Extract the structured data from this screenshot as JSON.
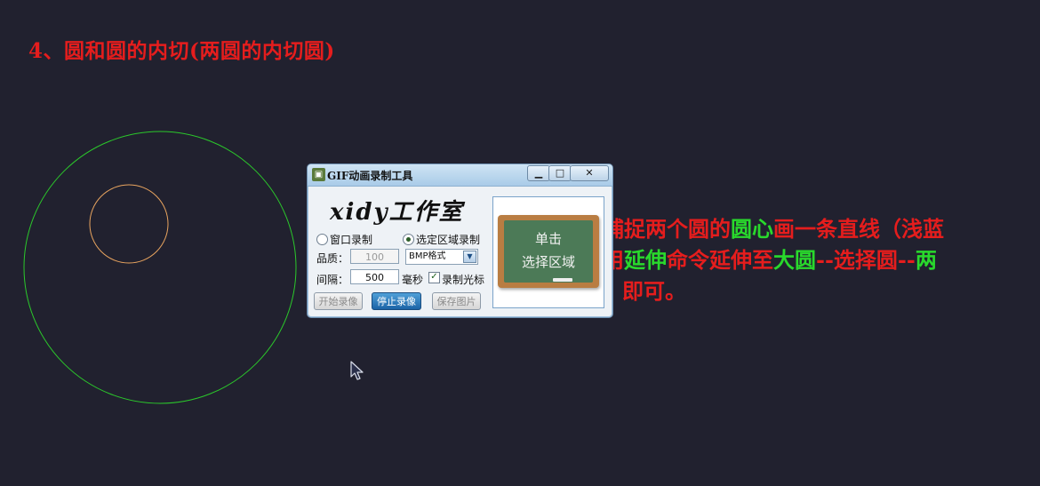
{
  "heading": "4、圆和圆的内切(两圆的内切圆)",
  "instructions": {
    "line1": [
      {
        "text": "捕捉两个圆的",
        "color": "red"
      },
      {
        "text": "圆心",
        "color": "green"
      },
      {
        "text": "画一条直线（浅蓝",
        "color": "red"
      }
    ],
    "line2": [
      {
        "text": "用",
        "color": "red"
      },
      {
        "text": "延伸",
        "color": "green"
      },
      {
        "text": "命令延伸至",
        "color": "red"
      },
      {
        "text": "大圆",
        "color": "green"
      },
      {
        "text": "--选择圆--",
        "color": "red"
      },
      {
        "text": "两",
        "color": "green"
      }
    ],
    "line3": [
      {
        "text": "即可。",
        "color": "red"
      }
    ]
  },
  "dialog": {
    "title": "GIF动画录制工具",
    "title_icon": "film-icon",
    "min_glyph": "▁",
    "max_glyph": "□",
    "close_glyph": "✕",
    "logo": "xidy工作室",
    "radio_window": "窗口录制",
    "radio_region": "选定区域录制",
    "quality_label": "品质：",
    "quality_value": "100",
    "format_value": "BMP格式",
    "interval_label": "间隔：",
    "interval_value": "500",
    "interval_unit": "毫秒",
    "cursor_checkbox_label": "录制光标",
    "btn_start": "开始录像",
    "btn_stop": "停止录像",
    "btn_save": "保存图片",
    "board_line1": "单击",
    "board_line2": "选择区域"
  },
  "colors": {
    "red": "#e51d1d",
    "green": "#29d92c",
    "background": "#21212f",
    "large_circle": "#2bc82b",
    "small_circle": "#e8a45f"
  }
}
